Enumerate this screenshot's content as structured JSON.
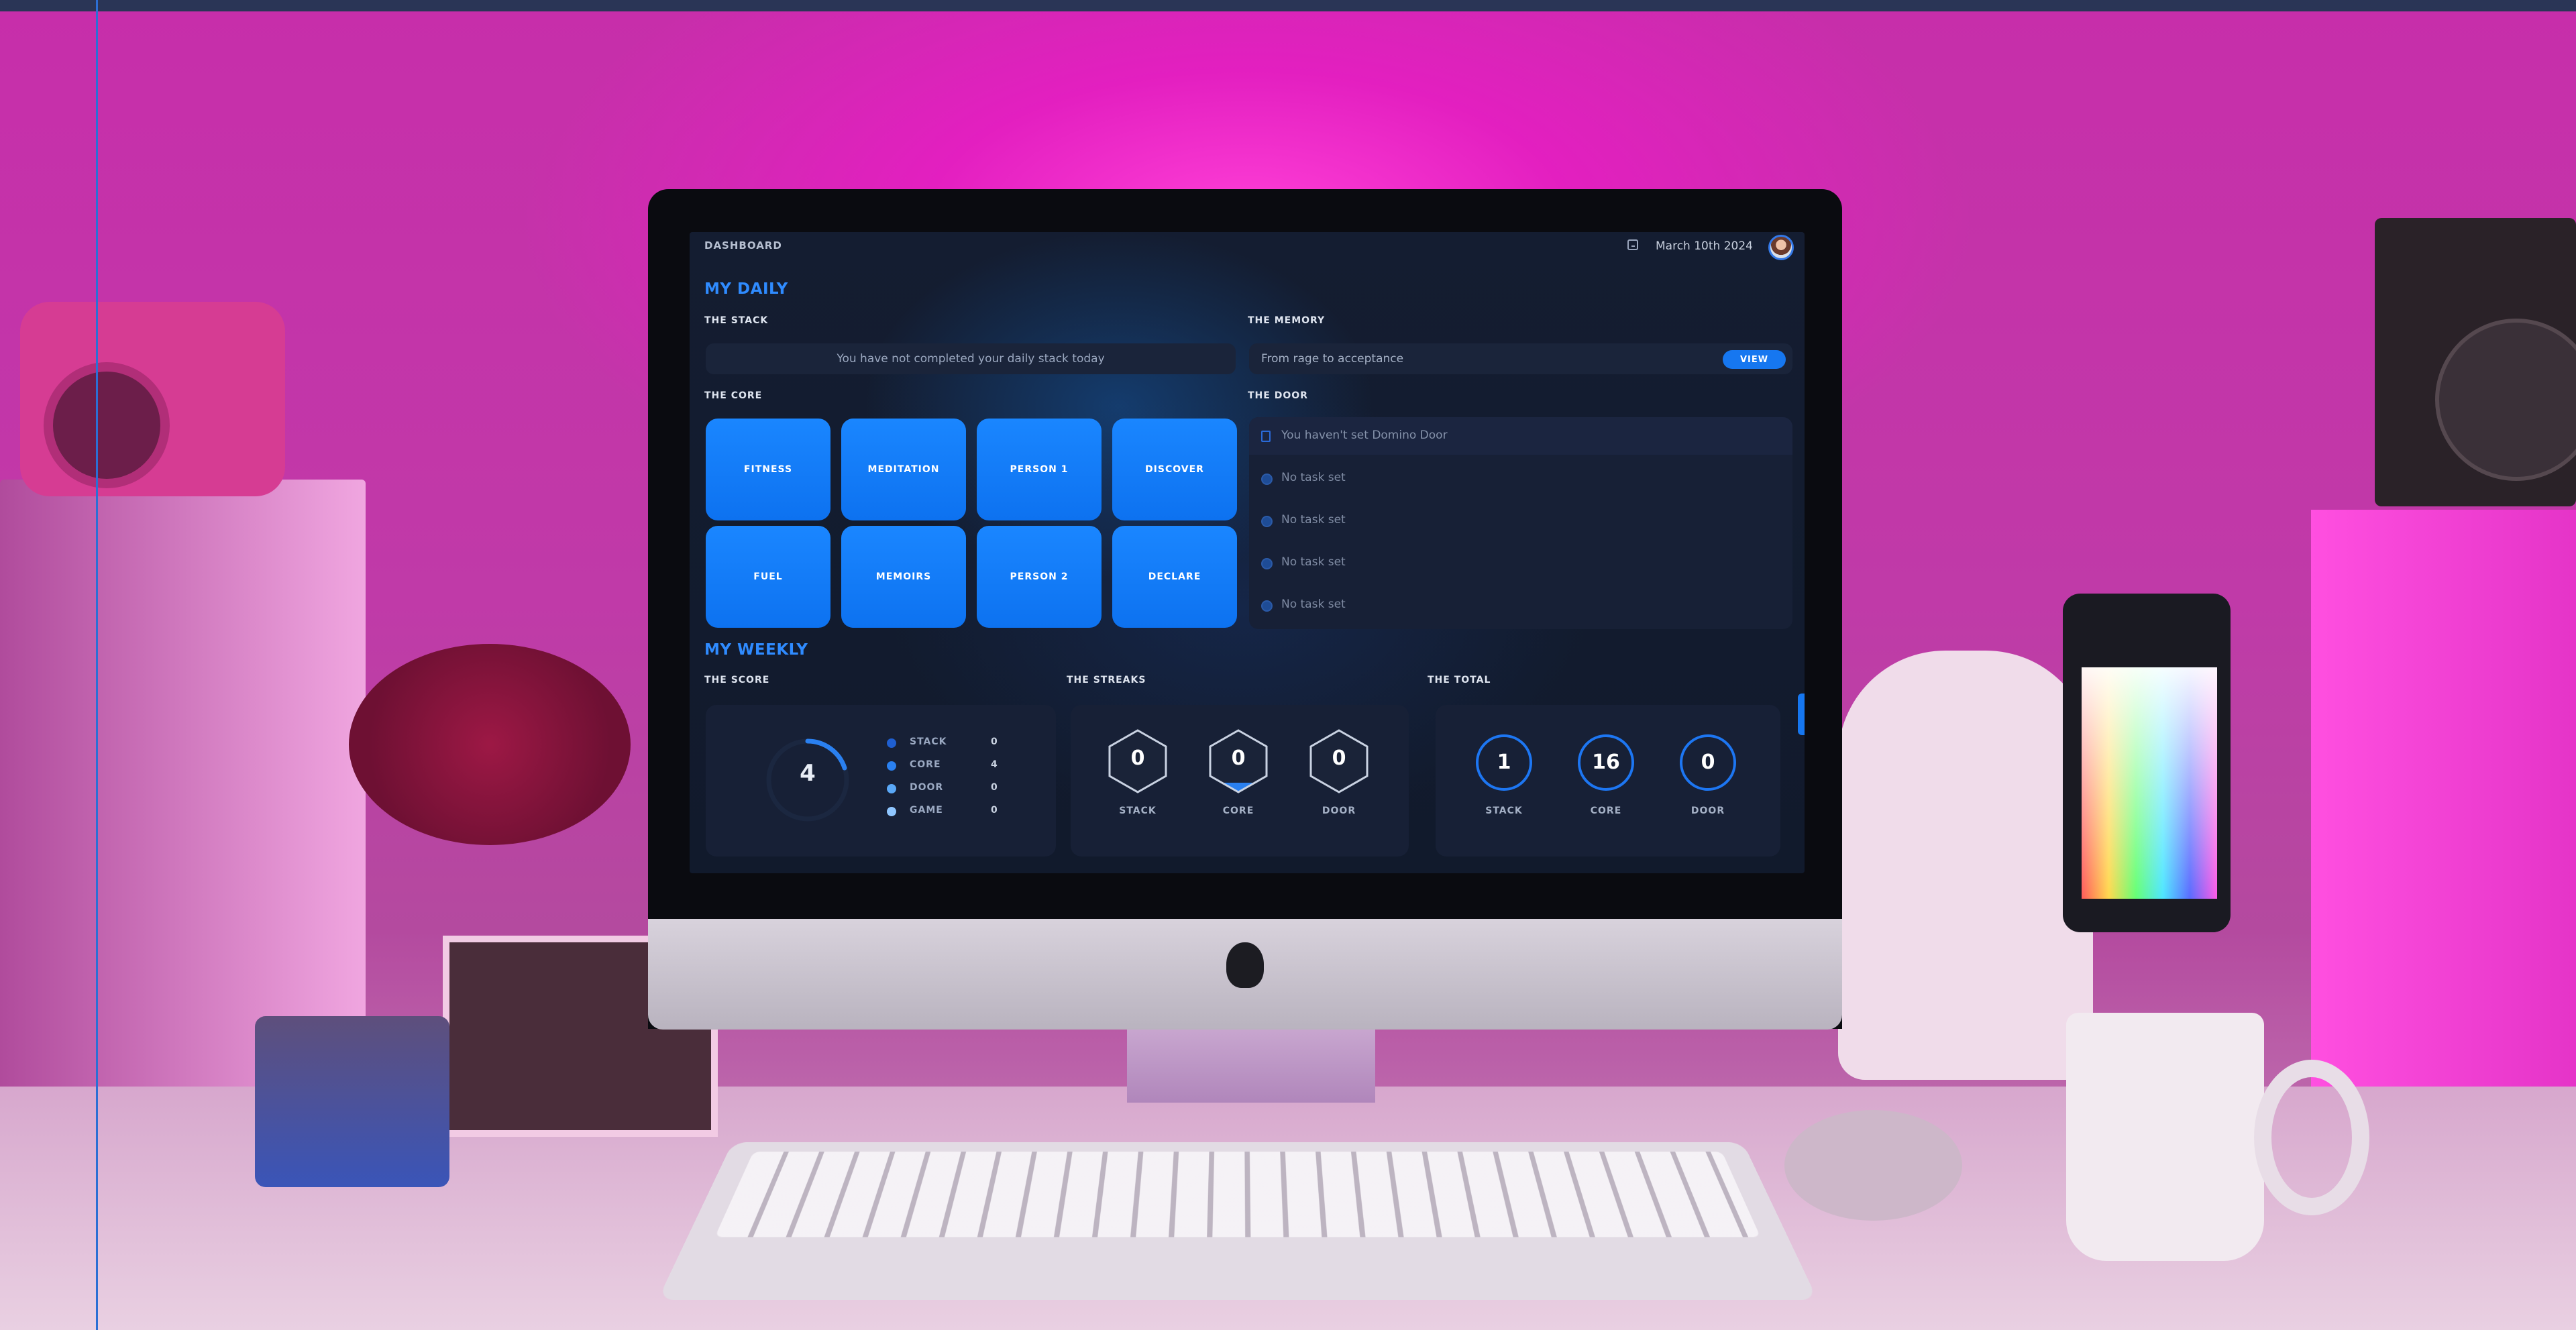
{
  "header": {
    "title": "DASHBOARD",
    "date": "March 10th 2024"
  },
  "daily": {
    "title": "MY DAILY",
    "stack": {
      "label": "THE STACK",
      "message": "You have not completed your daily stack today"
    },
    "memory": {
      "label": "THE MEMORY",
      "text": "From rage to acceptance",
      "button": "VIEW"
    },
    "core": {
      "label": "THE CORE",
      "tiles": [
        "FITNESS",
        "MEDITATION",
        "PERSON 1",
        "DISCOVER",
        "FUEL",
        "MEMOIRS",
        "PERSON 2",
        "DECLARE"
      ]
    },
    "door": {
      "label": "THE DOOR",
      "heading": "You haven't set Domino Door",
      "tasks": [
        "No task set",
        "No task set",
        "No task set",
        "No task set"
      ]
    }
  },
  "weekly": {
    "title": "MY WEEKLY",
    "score": {
      "label": "THE SCORE",
      "total": "4",
      "legend": [
        {
          "label": "STACK",
          "value": "0",
          "color": "#1f5fd1"
        },
        {
          "label": "CORE",
          "value": "4",
          "color": "#2a80f0"
        },
        {
          "label": "DOOR",
          "value": "0",
          "color": "#5aa8f7"
        },
        {
          "label": "GAME",
          "value": "0",
          "color": "#8fc6ff"
        }
      ]
    },
    "streaks": {
      "label": "THE STREAKS",
      "items": [
        {
          "label": "STACK",
          "value": "0"
        },
        {
          "label": "CORE",
          "value": "0"
        },
        {
          "label": "DOOR",
          "value": "0"
        }
      ]
    },
    "total": {
      "label": "THE TOTAL",
      "items": [
        {
          "label": "STACK",
          "value": "1"
        },
        {
          "label": "CORE",
          "value": "16"
        },
        {
          "label": "DOOR",
          "value": "0"
        }
      ]
    }
  },
  "colors": {
    "accent": "#1677f0",
    "panel": "#172036",
    "background": "#121b2e"
  }
}
